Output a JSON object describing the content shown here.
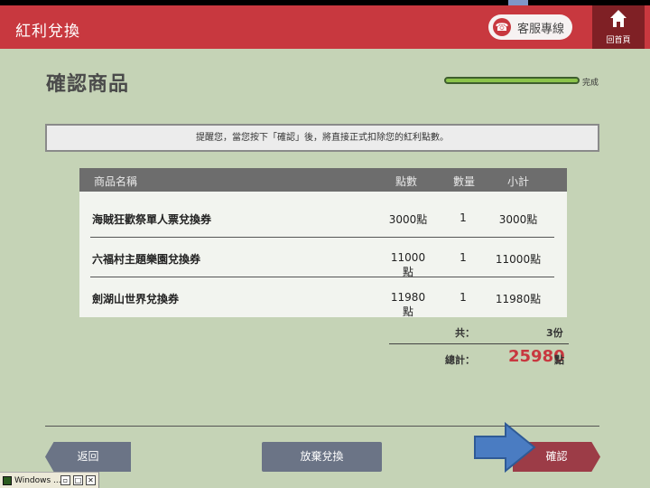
{
  "header": {
    "title": "紅利兌換",
    "hotline_label": "客服專線",
    "home_label": "回首頁"
  },
  "page": {
    "title": "確認商品",
    "progress_label": "完成",
    "progress_value": 1.0
  },
  "notice": "提醒您，當您按下「確認」後，將直接正式扣除您的紅利點數。",
  "table": {
    "columns": [
      "商品名稱",
      "點數",
      "數量",
      "小計"
    ],
    "rows": [
      {
        "name": "海賊狂歡祭單人票兌換券",
        "points": "3000點",
        "qty": "1",
        "subtotal": "3000點"
      },
      {
        "name": "六福村主題樂園兌換券",
        "points": "11000點",
        "qty": "1",
        "subtotal": "11000點"
      },
      {
        "name": "劍湖山世界兌換券",
        "points": "11980點",
        "qty": "1",
        "subtotal": "11980點"
      }
    ]
  },
  "totals": {
    "count_label": "共：",
    "count_value": "3份",
    "sum_label": "總計：",
    "sum_value": "25980",
    "sum_unit": "點"
  },
  "buttons": {
    "back": "返回",
    "quit": "放棄兌換",
    "confirm": "確認"
  },
  "taskbar": {
    "label": "Windows ..."
  },
  "colors": {
    "background": "#c5d3b6",
    "header": "#c8383f",
    "accent_total": "#c8383f",
    "progress": "#8bc34a",
    "confirm_button": "#9c3c47",
    "secondary_button": "#6b7486"
  }
}
